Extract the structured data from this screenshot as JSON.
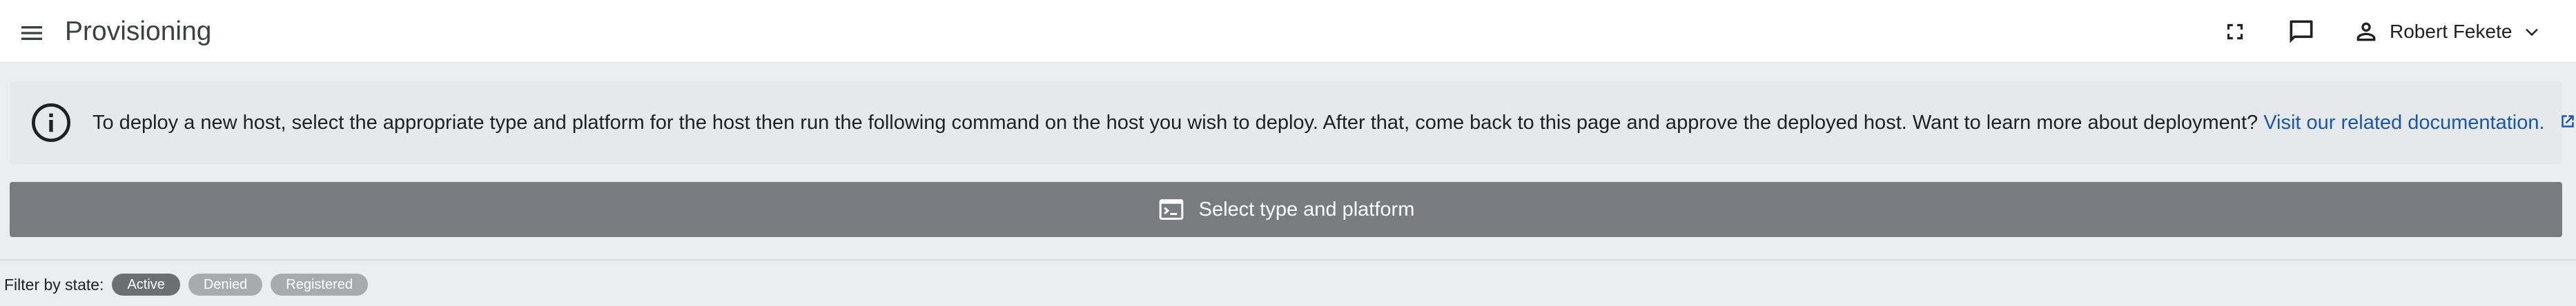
{
  "header": {
    "title": "Provisioning",
    "menu_icon": "hamburger-menu-icon",
    "fullscreen_icon": "fullscreen-icon",
    "feedback_icon": "chat-bubble-icon",
    "user": {
      "name": "Robert Fekete",
      "icon": "person-icon",
      "dropdown_icon": "chevron-down-icon"
    }
  },
  "info_banner": {
    "icon": "info-icon",
    "text": "To deploy a new host, select the appropriate type and platform for the host then run the following command on the host you wish to deploy. After that, come back to this page and approve the deployed host. Want to learn more about deployment?",
    "link_text": "Visit our related documentation.",
    "link_icon": "external-link-icon"
  },
  "select_bar": {
    "icon": "terminal-icon",
    "label": "Select type and platform"
  },
  "filter": {
    "label": "Filter by state:",
    "chips": [
      {
        "label": "Active",
        "selected": true
      },
      {
        "label": "Denied",
        "selected": false
      },
      {
        "label": "Registered",
        "selected": false
      }
    ]
  },
  "colors": {
    "accent_link": "#1a56b0",
    "select_bar_bg": "#787c80",
    "chip_active": "#6b6f73",
    "chip_inactive": "#a7abaf"
  }
}
